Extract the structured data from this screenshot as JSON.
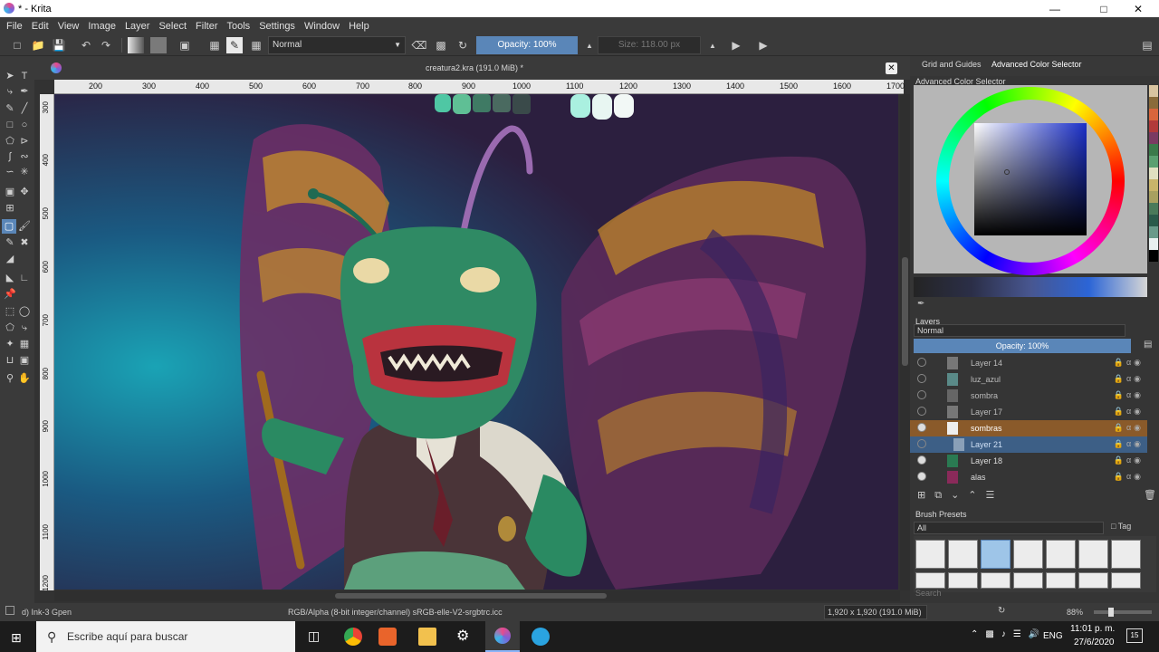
{
  "window": {
    "title": "* - Krita",
    "controls": [
      "minimize",
      "maximize",
      "close"
    ]
  },
  "menu": [
    "File",
    "Edit",
    "View",
    "Image",
    "Layer",
    "Select",
    "Filter",
    "Tools",
    "Settings",
    "Window",
    "Help"
  ],
  "toolbar": {
    "blend_mode": "Normal",
    "opacity": "Opacity: 100%",
    "size": "Size: 118.00 px"
  },
  "document": {
    "title": "creatura2.kra (191.0 MiB) *",
    "ruler_h": [
      "200",
      "300",
      "400",
      "500",
      "600",
      "700",
      "800",
      "900",
      "1000",
      "1100",
      "1200",
      "1300",
      "1400",
      "1500",
      "1600",
      "1700"
    ],
    "ruler_v": [
      "300",
      "400",
      "500",
      "600",
      "700",
      "800",
      "900",
      "1000",
      "1100",
      "1200"
    ]
  },
  "docker_tabs": {
    "tab1": "Grid and Guides",
    "tab2": "Advanced Color Selector"
  },
  "color_selector": {
    "title": "Advanced Color Selector",
    "hue_color": "#1a2fc8",
    "palette": [
      "#d9c4a0",
      "#8a6b3a",
      "#d8653c",
      "#b23a3a",
      "#7a3a62",
      "#3a7a4a",
      "#5aa070",
      "#e0e0c0",
      "#c8b46a",
      "#a8a060",
      "#4a7a5a",
      "#2a5a4a",
      "#6a9a8a",
      "#e8f0f0",
      "#000000"
    ]
  },
  "layers": {
    "title": "Layers",
    "blend_mode": "Normal",
    "opacity": "Opacity:  100%",
    "items": [
      {
        "name": "Layer 14",
        "visible": false,
        "selected": false
      },
      {
        "name": "luz_azul",
        "visible": false,
        "selected": false
      },
      {
        "name": "sombra",
        "visible": false,
        "selected": false
      },
      {
        "name": "Layer 17",
        "visible": false,
        "selected": false
      },
      {
        "name": "sombras",
        "visible": true,
        "selected": false,
        "highlight": "#8a5a2a"
      },
      {
        "name": "Layer 21",
        "visible": false,
        "selected": true,
        "highlight": "#3d5f86"
      },
      {
        "name": "Layer 18",
        "visible": true,
        "selected": false
      },
      {
        "name": "alas",
        "visible": true,
        "selected": false
      }
    ]
  },
  "brush_presets": {
    "title": "Brush Presets",
    "filter": "All",
    "tag": "Tag",
    "search_placeholder": "Search"
  },
  "status": {
    "brush": "d) Ink-3 Gpen",
    "color_space": "RGB/Alpha (8-bit integer/channel)  sRGB-elle-V2-srgbtrc.icc",
    "dimensions": "1,920 x 1,920 (191.0 MiB)",
    "zoom": "88%"
  },
  "taskbar": {
    "search_placeholder": "Escribe aquí para buscar",
    "language": "ENG",
    "time": "11:01 p. m.",
    "date": "27/6/2020",
    "notifications": "15"
  }
}
